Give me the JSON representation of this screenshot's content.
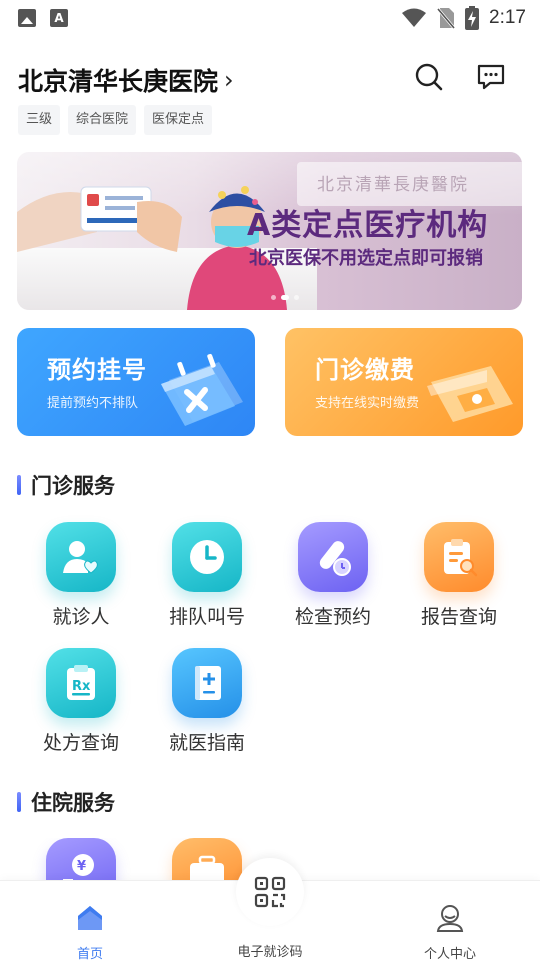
{
  "status_bar": {
    "time": "2:17",
    "icons": [
      "image-icon",
      "font-icon",
      "wifi-icon",
      "no-sim-icon",
      "battery-charging-icon"
    ]
  },
  "header": {
    "hospital_name": "北京清华长庚医院",
    "tags": [
      "三级",
      "综合医院",
      "医保定点"
    ]
  },
  "banner": {
    "headline": "A类定点医疗机构",
    "subline": "北京医保不用选定点即可报销",
    "sign_text": "北京清華長庚醫院",
    "slides": 3,
    "active_slide": 1
  },
  "action_cards": [
    {
      "title": "预约挂号",
      "subtitle": "提前预约不排队",
      "color": "#2e86f5"
    },
    {
      "title": "门诊缴费",
      "subtitle": "支持在线实时缴费",
      "color": "#ff9a2a"
    }
  ],
  "outpatient": {
    "section_title": "门诊服务",
    "items": [
      {
        "label": "就诊人",
        "icon": "patient-icon"
      },
      {
        "label": "排队叫号",
        "icon": "clock-icon"
      },
      {
        "label": "检查预约",
        "icon": "test-tube-icon"
      },
      {
        "label": "报告查询",
        "icon": "report-search-icon"
      },
      {
        "label": "处方查询",
        "icon": "prescription-icon"
      },
      {
        "label": "就医指南",
        "icon": "guide-book-icon"
      }
    ]
  },
  "inpatient": {
    "section_title": "住院服务",
    "items": [
      {
        "icon": "yuan-payment-icon"
      },
      {
        "icon": "medical-kit-icon"
      }
    ]
  },
  "bottom_nav": {
    "home": "首页",
    "code": "电子就诊码",
    "profile": "个人中心",
    "accent": "#3f7cf0"
  }
}
